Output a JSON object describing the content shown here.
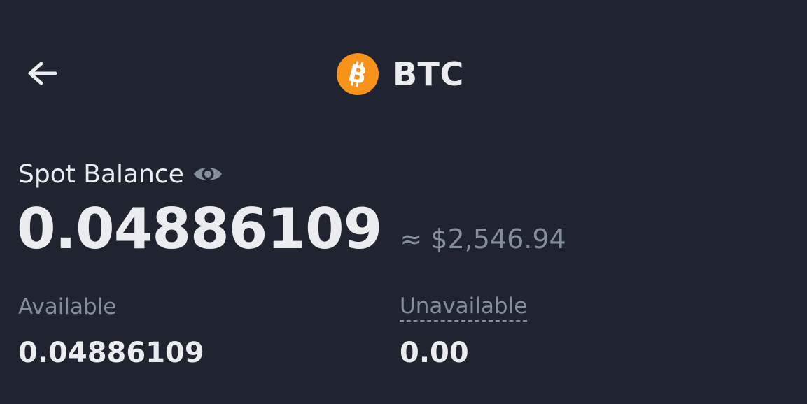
{
  "header": {
    "coin_symbol": "BTC",
    "coin_color": "#f7931a",
    "back_icon": "arrow-left-icon",
    "coin_icon": "bitcoin-logo-icon"
  },
  "balance": {
    "label": "Spot Balance",
    "visibility_icon": "eye-icon",
    "amount": "0.04886109",
    "fiat_value": "≈ $2,546.94"
  },
  "details": {
    "available_label": "Available",
    "available_value": "0.04886109",
    "unavailable_label": "Unavailable",
    "unavailable_value": "0.00"
  },
  "colors": {
    "background": "#1f2430",
    "primary_text": "#eaecef",
    "secondary_text": "#848e9c"
  }
}
